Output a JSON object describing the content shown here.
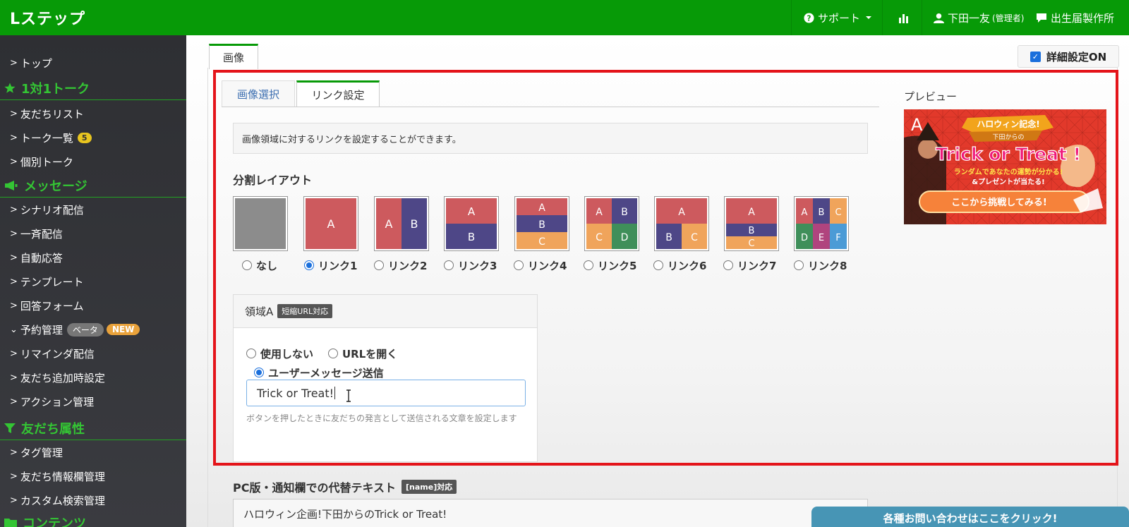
{
  "header": {
    "logo": "Lステップ",
    "support": "サポート",
    "user_name": "下田一友",
    "user_role": "(管理者)",
    "account": "出生届製作所"
  },
  "sidebar": {
    "top": "トップ",
    "section_talk": "1対1トーク",
    "friend_list": "友だちリスト",
    "talk_list": "トーク一覧",
    "talk_badge": "5",
    "individual_talk": "個別トーク",
    "section_message": "メッセージ",
    "scenario": "シナリオ配信",
    "broadcast": "一斉配信",
    "auto_reply": "自動応答",
    "template": "テンプレート",
    "answer_form": "回答フォーム",
    "reservation": "予約管理",
    "beta_badge": "ベータ",
    "new_badge": "NEW",
    "reminder": "リマインダ配信",
    "add_friend_setting": "友だち追加時設定",
    "action_mgmt": "アクション管理",
    "section_attr": "友だち属性",
    "tag_mgmt": "タグ管理",
    "friend_info": "友だち情報欄管理",
    "custom_search": "カスタム検索管理",
    "section_content": "コンテンツ"
  },
  "main": {
    "tab_image": "画像",
    "detail_setting": "詳細設定ON",
    "tab_select_image": "画像選択",
    "tab_link_setting": "リンク設定",
    "info_text": "画像領域に対するリンクを設定することができます。",
    "layout_label": "分割レイアウト",
    "layout_options": [
      "なし",
      "リンク1",
      "リンク2",
      "リンク3",
      "リンク4",
      "リンク5",
      "リンク6",
      "リンク7",
      "リンク8"
    ],
    "selected_layout": "リンク1",
    "region_title": "領域A",
    "region_tag": "短縮URL対応",
    "opt_unused": "使用しない",
    "opt_open_url": "URLを開く",
    "opt_user_message": "ユーザーメッセージ送信",
    "message_value": "Trick or Treat!",
    "help_text": "ボタンを押したときに友だちの発言として送信される文章を設定します",
    "preview_label": "プレビュー",
    "preview": {
      "area_letter": "A",
      "banner": "ハロウィン記念!",
      "from": "下田からの",
      "title": "Trick or Treat !",
      "line1": "ランダムであなたの運勢が分かる!",
      "line2": "&プレゼントが当たる!",
      "cta": "ここから挑戦してみる!"
    },
    "pc_label": "PC版・通知欄での代替テキスト",
    "pc_tag": "[name]対応",
    "pc_value": "ハロウィン企画!下田からのTrick or Treat!",
    "contact_button": "各種お問い合わせはここをクリック!"
  },
  "colors": {
    "brand_green": "#079a07",
    "tile_red": "#cd5a5e",
    "tile_navy": "#4e4787",
    "tile_orange": "#f0a45b",
    "tile_green": "#3f8f5a",
    "tile_magenta": "#b0447e",
    "tile_blue": "#4b9bd6",
    "tile_gray": "#8c8c8c",
    "highlight_red": "#e4141a"
  }
}
